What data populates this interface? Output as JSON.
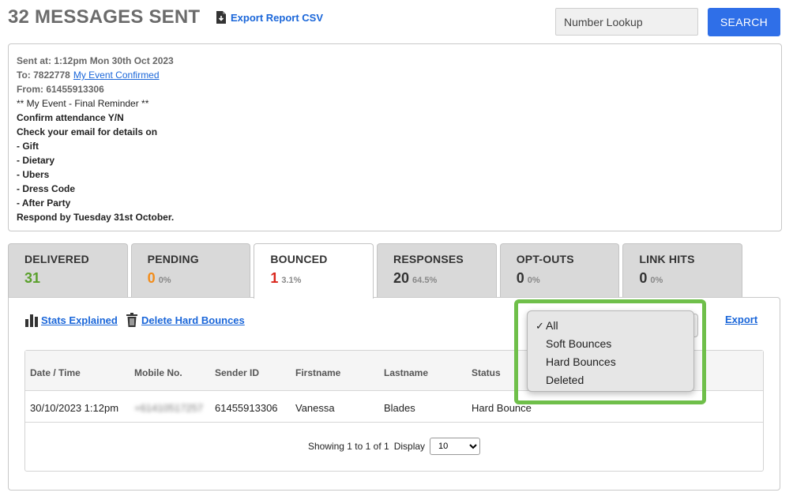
{
  "header": {
    "title": "32 MESSAGES SENT",
    "export_csv_label": "Export Report CSV",
    "lookup_placeholder": "Number Lookup",
    "search_label": "SEARCH"
  },
  "message": {
    "sent_at": "Sent at: 1:12pm Mon 30th Oct 2023",
    "to_label": "To: 7822778",
    "to_link": "My Event Confirmed",
    "from": "From: 61455913306",
    "lines": [
      "** My Event - Final Reminder **",
      "Confirm attendance Y/N",
      "Check your email for details on",
      "- Gift",
      "- Dietary",
      "- Ubers",
      "- Dress Code",
      "- After Party",
      "Respond by Tuesday 31st October."
    ]
  },
  "tabs": [
    {
      "label": "DELIVERED",
      "count": "31",
      "pct": "",
      "color": "#5aa02c"
    },
    {
      "label": "PENDING",
      "count": "0",
      "pct": "0%",
      "color": "#f28c1a"
    },
    {
      "label": "BOUNCED",
      "count": "1",
      "pct": "3.1%",
      "color": "#d9261c"
    },
    {
      "label": "RESPONSES",
      "count": "20",
      "pct": "64.5%",
      "color": "#333333"
    },
    {
      "label": "OPT-OUTS",
      "count": "0",
      "pct": "0%",
      "color": "#333333"
    },
    {
      "label": "LINK HITS",
      "count": "0",
      "pct": "0%",
      "color": "#333333"
    }
  ],
  "toolbar": {
    "stats_label": "Stats Explained",
    "delete_label": "Delete Hard Bounces",
    "export_label": "Export"
  },
  "dropdown": {
    "options": [
      "All",
      "Soft Bounces",
      "Hard Bounces",
      "Deleted"
    ],
    "selected": "All",
    "check": "✓",
    "highlight_color": "#6fbf4a"
  },
  "table": {
    "headers": [
      "Date / Time",
      "Mobile No.",
      "Sender ID",
      "Firstname",
      "Lastname",
      "Status"
    ],
    "rows": [
      [
        "30/10/2023 1:12pm",
        "+61410517257",
        "61455913306",
        "Vanessa",
        "Blades",
        "Hard Bounce"
      ]
    ],
    "pager_text": "Showing 1 to 1 of 1",
    "display_label": "Display",
    "display_value": "10"
  }
}
